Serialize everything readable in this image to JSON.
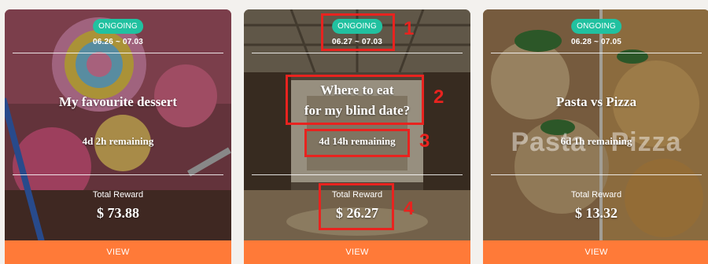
{
  "cards": [
    {
      "status": "ONGOING",
      "dates": "06.26 ~ 07.03",
      "title": "My favourite dessert",
      "remaining": "4d 2h remaining",
      "reward_label": "Total Reward",
      "reward_value": "$ 73.88",
      "cta": "VIEW"
    },
    {
      "status": "ONGOING",
      "dates": "06.27 ~ 07.03",
      "title": "Where to eat\nfor my blind date?",
      "remaining": "4d 14h remaining",
      "reward_label": "Total Reward",
      "reward_value": "$ 26.27",
      "cta": "VIEW"
    },
    {
      "status": "ONGOING",
      "dates": "06.28 ~ 07.05",
      "title": "Pasta vs Pizza",
      "remaining": "6d 1h remaining",
      "reward_label": "Total Reward",
      "reward_value": "$ 13.32",
      "cta": "VIEW",
      "image_text": "Pasta   Pizza"
    }
  ],
  "annotations": [
    "1",
    "2",
    "3",
    "4"
  ],
  "colors": {
    "status_badge": "#21c1a0",
    "view_button": "#ff7a38",
    "annotation": "#e8231f"
  }
}
